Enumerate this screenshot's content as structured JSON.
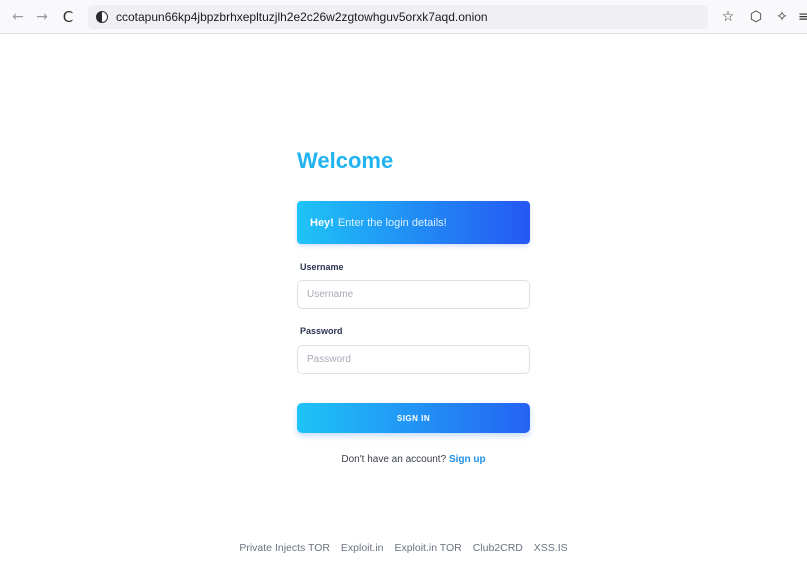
{
  "browser": {
    "url": "ccotapun66kp4jbpzbrhxepltuzjlh2e2c26w2zgtowhguv5orxk7aqd.onion",
    "back_glyph": "←",
    "forward_glyph": "→",
    "reload_glyph": "C",
    "star_glyph": "☆",
    "shield_glyph": "⬡",
    "wand_glyph": "✧",
    "menu_glyph": "≡"
  },
  "page": {
    "title": "Welcome",
    "alert": {
      "strong": "Hey!",
      "text": "Enter the login details!"
    },
    "username": {
      "label": "Username",
      "placeholder": "Username",
      "value": ""
    },
    "password": {
      "label": "Password",
      "placeholder": "Password",
      "value": ""
    },
    "signin_label": "SIGN IN",
    "signup_prompt": "Don't have an account?",
    "signup_link": "Sign up"
  },
  "footer": {
    "links": [
      "Private Injects TOR",
      "Exploit.in",
      "Exploit.in TOR",
      "Club2CRD",
      "XSS.IS"
    ]
  },
  "colors": {
    "title": "#1fb3f0",
    "gradient_start": "#1ec4f7",
    "gradient_end": "#2557f3",
    "link": "#1f8fe8"
  }
}
